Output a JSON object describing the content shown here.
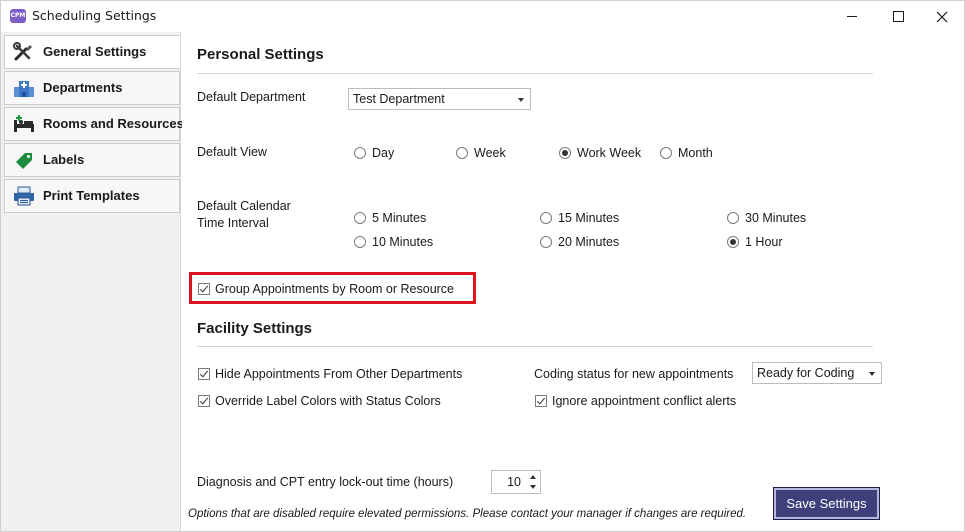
{
  "window": {
    "title": "Scheduling Settings",
    "app_icon_text": "CPM"
  },
  "sidebar": {
    "items": [
      {
        "label": "General Settings",
        "icon": "tools-icon",
        "active": true
      },
      {
        "label": "Departments",
        "icon": "hospital-building-icon",
        "active": false
      },
      {
        "label": "Rooms and Resources",
        "icon": "bed-icon",
        "active": false
      },
      {
        "label": "Labels",
        "icon": "tag-icon",
        "active": false
      },
      {
        "label": "Print Templates",
        "icon": "printer-icon",
        "active": false
      }
    ]
  },
  "personal": {
    "title": "Personal Settings",
    "default_department": {
      "label": "Default Department",
      "value": "Test Department"
    },
    "default_view": {
      "label": "Default View",
      "options": [
        "Day",
        "Week",
        "Work Week",
        "Month"
      ],
      "selected": "Work Week"
    },
    "interval": {
      "label_line1": "Default Calendar",
      "label_line2": "Time Interval",
      "options": [
        "5 Minutes",
        "15 Minutes",
        "30 Minutes",
        "10 Minutes",
        "20 Minutes",
        "1 Hour"
      ],
      "selected": "1 Hour"
    },
    "group_by_room": {
      "label": "Group Appointments by Room or Resource",
      "checked": true
    }
  },
  "facility": {
    "title": "Facility Settings",
    "hide_other_departments": {
      "label": "Hide Appointments From Other Departments",
      "checked": true
    },
    "override_label_colors": {
      "label": "Override Label Colors with Status Colors",
      "checked": true
    },
    "coding_status": {
      "label": "Coding status for new appointments",
      "value": "Ready for Coding"
    },
    "ignore_conflicts": {
      "label": "Ignore appointment conflict alerts",
      "checked": true
    }
  },
  "lockout": {
    "label": "Diagnosis and CPT entry lock-out time (hours)",
    "value": "10"
  },
  "footer": {
    "note": "Options that are disabled require elevated permissions.  Please contact your manager if changes are required.",
    "save_label": "Save Settings"
  },
  "colors": {
    "highlight": "#e0141e",
    "save_button": "#3f3f7c",
    "app_icon": "#7e5fc5"
  }
}
